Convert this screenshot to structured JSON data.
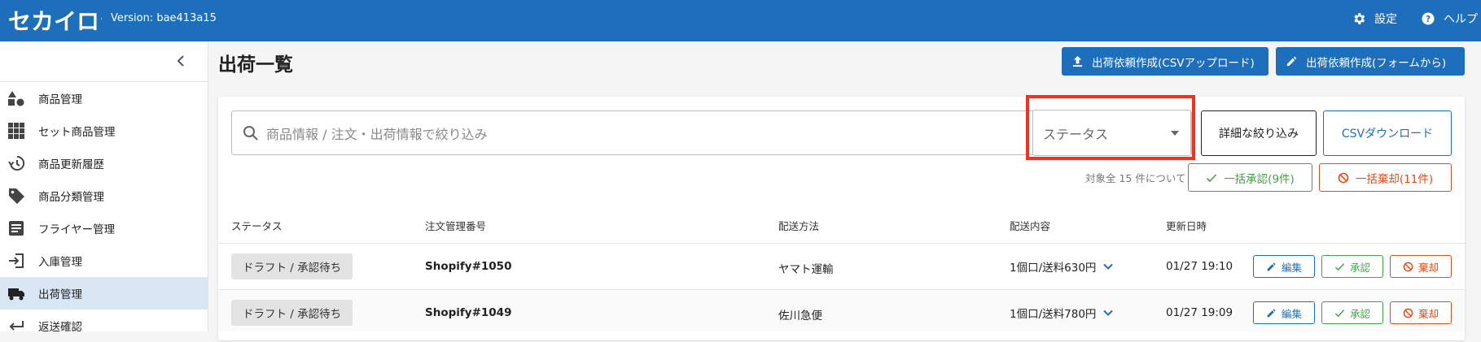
{
  "header": {
    "version": "Version: bae413a15",
    "settings_label": "設定",
    "help_label": "ヘルプ",
    "logo_text": "セカイロジ"
  },
  "sidebar": {
    "items": [
      {
        "label": "商品管理",
        "icon": "shapes-icon"
      },
      {
        "label": "セット商品管理",
        "icon": "grid-icon"
      },
      {
        "label": "商品更新履歴",
        "icon": "history-icon"
      },
      {
        "label": "商品分類管理",
        "icon": "tag-icon"
      },
      {
        "label": "フライヤー管理",
        "icon": "flyer-icon"
      },
      {
        "label": "入庫管理",
        "icon": "login-icon"
      },
      {
        "label": "出荷管理",
        "icon": "truck-icon"
      },
      {
        "label": "返送確認",
        "icon": "return-icon"
      }
    ]
  },
  "main": {
    "title": "出荷一覧",
    "btn_csv_upload": "出荷依頼作成(CSVアップロード)",
    "btn_form_create": "出荷依頼作成(フォームから)",
    "search_placeholder": "商品情報 / 注文・出荷情報で絞り込み",
    "status_placeholder": "ステータス",
    "btn_detail_filter": "詳細な絞り込み",
    "btn_csv_download": "CSVダウンロード",
    "count_text": "対象全 15 件について",
    "btn_approve_all": "一括承認(9件)",
    "btn_reject_all": "一括棄却(11件)"
  },
  "table": {
    "headers": [
      "ステータス",
      "注文管理番号",
      "配送方法",
      "配送内容",
      "更新日時"
    ],
    "rows": [
      {
        "status": "ドラフト / 承認待ち",
        "order": "Shopify#1050",
        "method": "ヤマト運輸",
        "content": "1個口/送料630円",
        "updated": "01/27 19:10",
        "edit": "編集",
        "approve": "承認",
        "reject": "棄却"
      },
      {
        "status": "ドラフト / 承認待ち",
        "order": "Shopify#1049",
        "method": "佐川急便",
        "content": "1個口/送料780円",
        "updated": "01/27 19:09",
        "edit": "編集",
        "approve": "承認",
        "reject": "棄却"
      }
    ]
  },
  "colors": {
    "header_bg": "#1e6fbb",
    "highlight": "#ee3322",
    "approve": "#43a047",
    "reject": "#e64a19"
  }
}
